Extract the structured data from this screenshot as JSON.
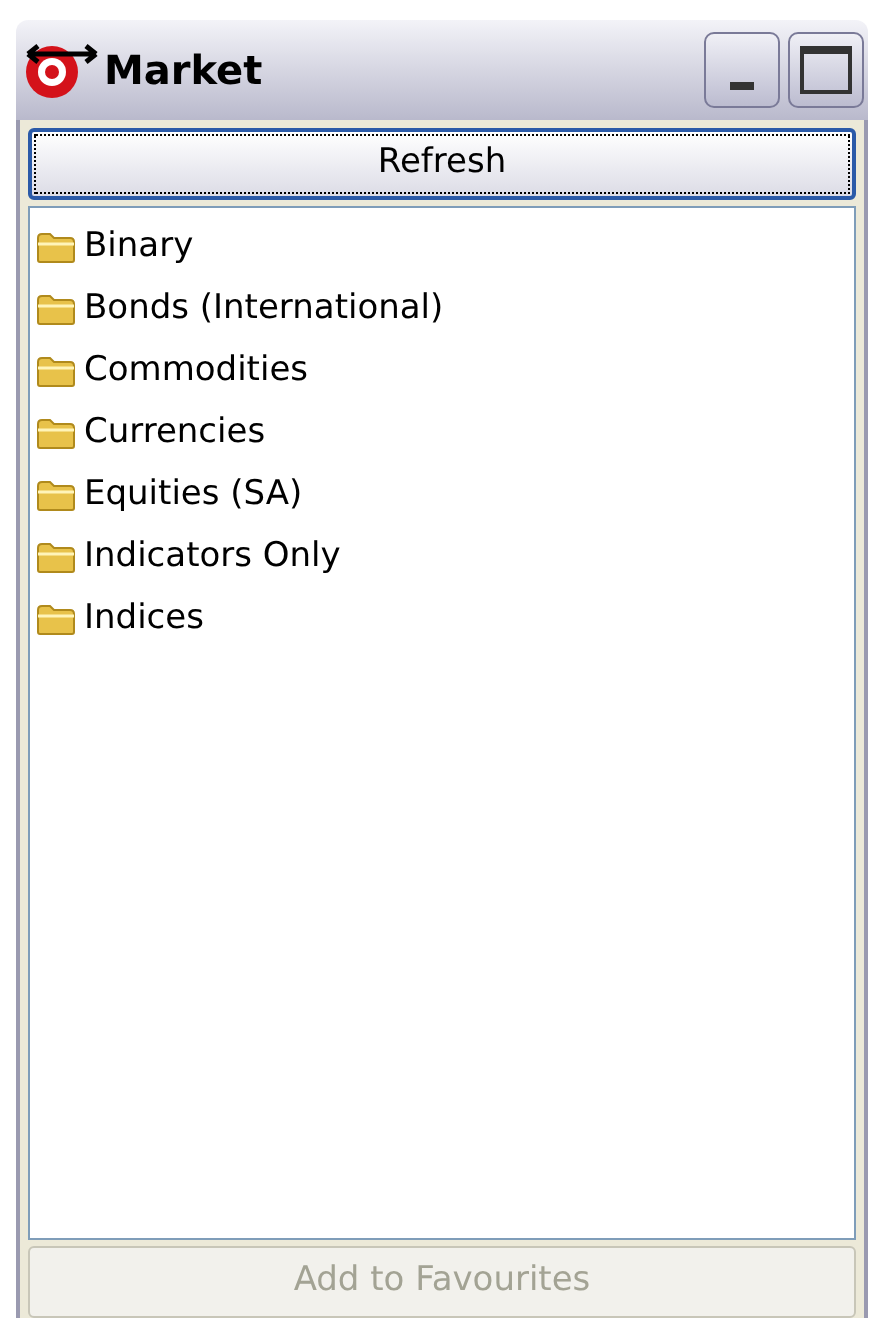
{
  "window": {
    "title": "Market"
  },
  "refresh_button": {
    "label": "Refresh",
    "focused": true
  },
  "tree": {
    "items": [
      {
        "label": "Binary"
      },
      {
        "label": "Bonds (International)"
      },
      {
        "label": "Commodities"
      },
      {
        "label": "Currencies"
      },
      {
        "label": "Equities (SA)"
      },
      {
        "label": "Indicators Only"
      },
      {
        "label": "Indices"
      }
    ]
  },
  "favourites_button": {
    "label": "Add to Favourites",
    "disabled": true
  }
}
